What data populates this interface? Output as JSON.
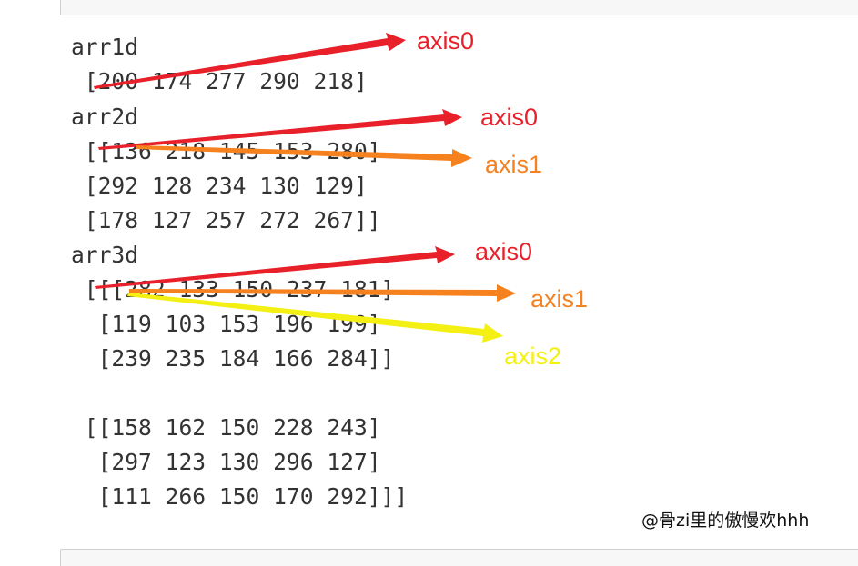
{
  "output_lines": [
    "arr1d",
    " [200 174 277 290 218]",
    "arr2d",
    " [[136 218 145 153 280]",
    " [292 128 234 130 129]",
    " [178 127 257 272 267]]",
    "arr3d",
    " [[[282 133 150 237 181]",
    "  [119 103 153 196 199]",
    "  [239 235 184 166 284]]",
    "",
    " [[158 162 150 228 243]",
    "  [297 123 130 296 127]",
    "  [111 266 150 170 292]]]"
  ],
  "annotations": {
    "arr1d_axis0": "axis0",
    "arr2d_axis0": "axis0",
    "arr2d_axis1": "axis1",
    "arr3d_axis0": "axis0",
    "arr3d_axis1": "axis1",
    "arr3d_axis2": "axis2"
  },
  "colors": {
    "axis0": "#e8202a",
    "axis1": "#f5811f",
    "axis2": "#f4f013"
  },
  "watermark": "@骨zi里的傲慢欢hhh"
}
